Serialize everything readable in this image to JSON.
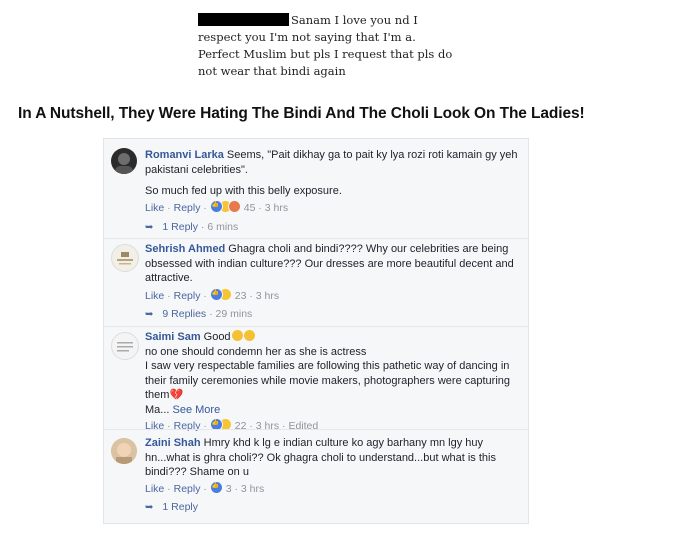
{
  "quote": {
    "line1": "Sanam I love you nd I",
    "line2": "respect you I'm not saying that I'm a.",
    "line3": "Perfect Muslim but pls I request that pls do",
    "line4": "not wear that bindi again"
  },
  "headline": "In A Nutshell, They Were Hating The Bindi And The Choli Look On The Ladies!",
  "comments": [
    {
      "author": "Romanvi Larka",
      "text": "Seems, \"Pait dikhay ga to pait ky lya rozi roti kamain gy yeh pakistani celebrities\".",
      "text2": "So much fed up with this belly exposure.",
      "like": "Like",
      "reply": "Reply",
      "count": "45",
      "time": "3 hrs",
      "replies": "1 Reply",
      "replies_time": "6 mins"
    },
    {
      "author": "Sehrish Ahmed",
      "text": "Ghagra choli and bindi???? Why our celebrities are being obsessed with indian culture??? Our dresses are more beautiful decent and attractive.",
      "like": "Like",
      "reply": "Reply",
      "count": "23",
      "time": "3 hrs",
      "replies": "9 Replies",
      "replies_time": "29 mins"
    },
    {
      "author": "Saimi Sam",
      "text": "Good",
      "text2": "no one should condemn her as she is actress",
      "text3": "I saw very respectable families are following this pathetic way of dancing in their family ceremonies while movie makers, photographers were capturing them",
      "text4": "Ma...",
      "see_more": "See More",
      "like": "Like",
      "reply": "Reply",
      "count": "22",
      "time": "3 hrs",
      "edited": "Edited"
    },
    {
      "author": "Zaini Shah",
      "text": "Hmry khd k lg e indian culture ko agy barhany mn lgy huy hn...what is ghra choli?? Ok ghagra choli to understand...but what is this bindi??? Shame on u",
      "like": "Like",
      "reply": "Reply",
      "count": "3",
      "time": "3 hrs",
      "replies": "1 Reply"
    }
  ],
  "colors": {
    "link": "#365899",
    "muted": "#90949c",
    "panel": "#f6f7f9"
  }
}
